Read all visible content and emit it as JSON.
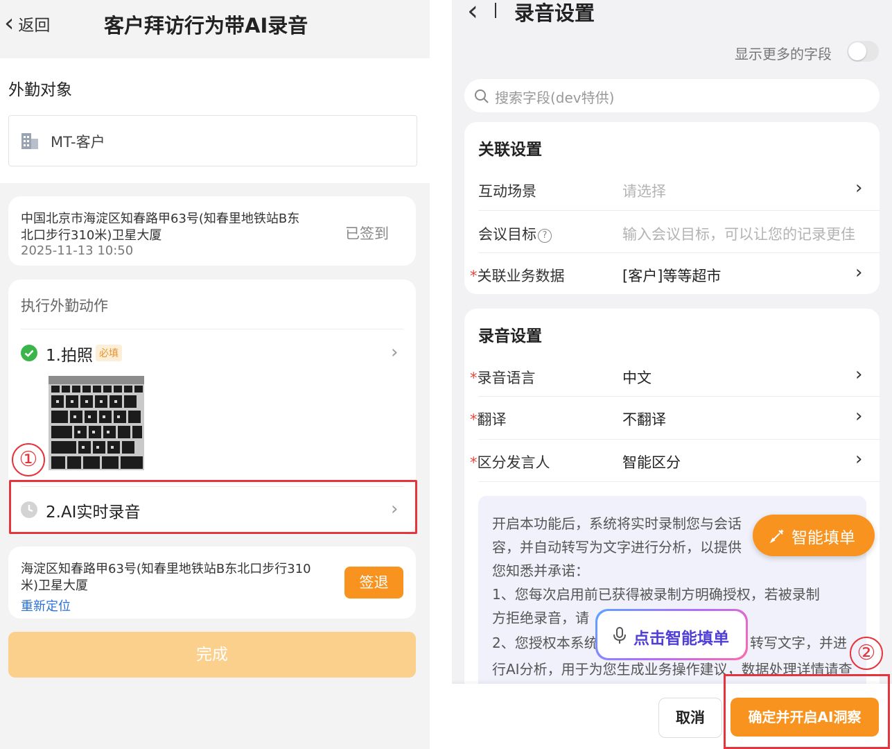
{
  "left": {
    "back_label": "返回",
    "title": "客户拜访行为带AI录音",
    "visit_target_label": "外勤对象",
    "customer_value": "MT-客户",
    "checkin": {
      "address": "中国北京市海淀区知春路甲63号(知春里地铁站B东北口步行310米)卫星大厦",
      "address_line1": "中国北京市海淀区知春路甲63号(知春里地铁站B东",
      "address_line2": "北口步行310米)卫星大厦",
      "time": "2025-11-13 10:50",
      "status": "已签到"
    },
    "actions": {
      "header": "执行外勤动作",
      "photo_label": "1.拍照",
      "required_badge": "必填",
      "ai_recording_label": "2.AI实时录音"
    },
    "checkout": {
      "address_line1": "海淀区知春路甲63号(知春里地铁站B东北口步行310",
      "address_line2": "米)卫星大厦",
      "relocate": "重新定位",
      "checkout_button": "签退"
    },
    "done_button": "完成",
    "annotation_1": "①"
  },
  "right": {
    "title": "录音设置",
    "show_more_fields": "显示更多的字段",
    "search_placeholder": "搜索字段(dev特供)",
    "association": {
      "header": "关联设置",
      "scene_label": "互动场景",
      "scene_placeholder": "请选择",
      "goal_label": "会议目标",
      "goal_placeholder": "输入会议目标，可以让您的记录更佳",
      "related_label": "关联业务数据",
      "related_value": "[客户]等等超市"
    },
    "recording": {
      "header": "录音设置",
      "language_label": "录音语言",
      "language_value": "中文",
      "translate_label": "翻译",
      "translate_value": "不翻译",
      "speaker_label": "区分发言人",
      "speaker_value": "智能区分"
    },
    "notice": {
      "line1": "开启本功能后，系统将实时录制您与会话",
      "line2": "容，并自动转写为文字进行分析，以提供",
      "line3": "您知悉并承诺：",
      "line4": "1、您每次启用前已获得被录制方明确授权，若被录制",
      "line5": "方拒绝录音，请",
      "line6a": "2、您授权本系统",
      "line6b": "转写文字，并进",
      "line7": "行AI分析，用于为您生成业务操作建议，数据处理详情请查"
    },
    "smart_fill_button": "智能填单",
    "voice_fill_button": "点击智能填单",
    "cancel_button": "取消",
    "confirm_button": "确定并开启AI洞察",
    "annotation_2": "②",
    "colors": {
      "orange": "#f7931e",
      "red_outline": "#e5343b",
      "link_blue": "#2b6fd6"
    }
  }
}
